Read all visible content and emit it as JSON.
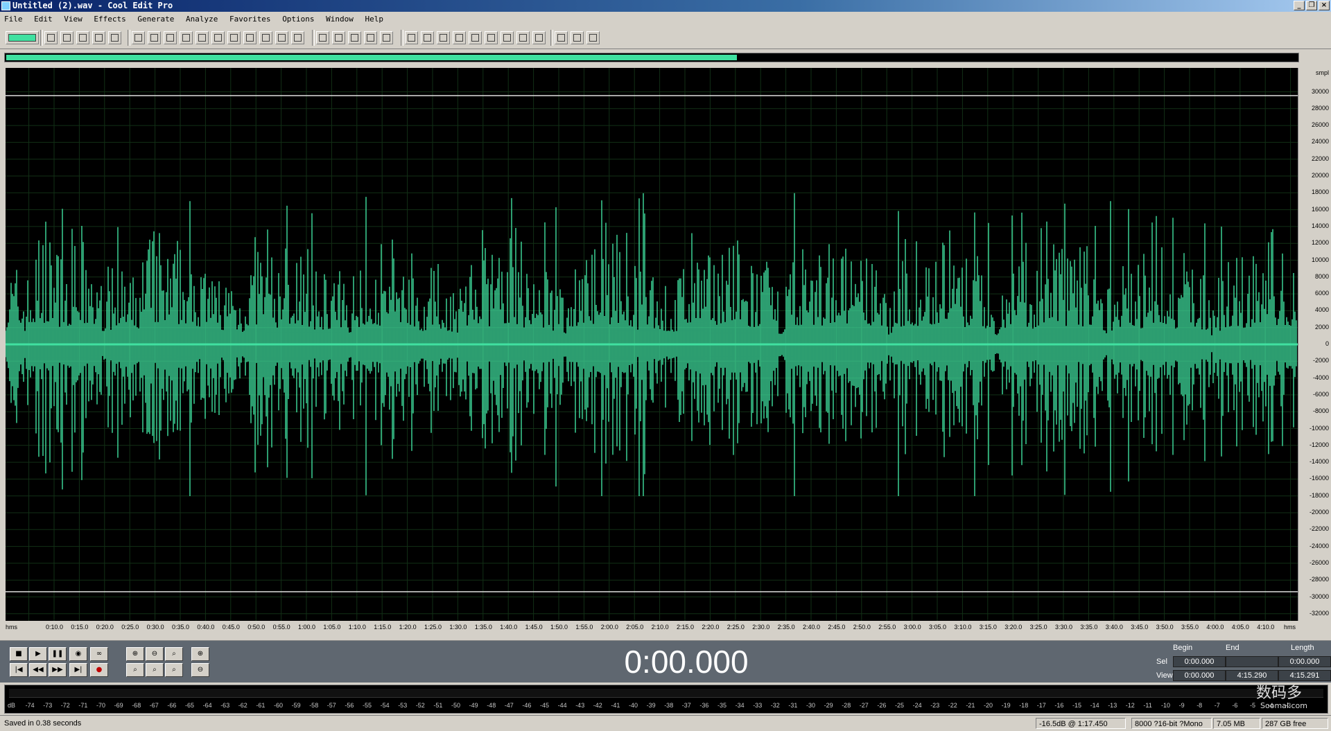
{
  "window": {
    "title": "Untitled (2).wav - Cool Edit Pro"
  },
  "menu": [
    "File",
    "Edit",
    "View",
    "Effects",
    "Generate",
    "Analyze",
    "Favorites",
    "Options",
    "Window",
    "Help"
  ],
  "colors": {
    "waveform": "#40e0a0",
    "background": "#000000",
    "grid": "#123016"
  },
  "waveform": {
    "amplitude_unit": "smpl",
    "amplitude_labels": [
      "30000",
      "28000",
      "26000",
      "24000",
      "22000",
      "20000",
      "18000",
      "16000",
      "14000",
      "12000",
      "10000",
      "8000",
      "6000",
      "4000",
      "2000",
      "0",
      "-2000",
      "-4000",
      "-6000",
      "-8000",
      "-10000",
      "-12000",
      "-14000",
      "-16000",
      "-18000",
      "-20000",
      "-22000",
      "-24000",
      "-26000",
      "-28000",
      "-30000",
      "-32000"
    ]
  },
  "timeline": {
    "unit_left": "hms",
    "unit_right": "hms",
    "labels": [
      "0:10.0",
      "0:15.0",
      "0:20.0",
      "0:25.0",
      "0:30.0",
      "0:35.0",
      "0:40.0",
      "0:45.0",
      "0:50.0",
      "0:55.0",
      "1:00.0",
      "1:05.0",
      "1:10.0",
      "1:15.0",
      "1:20.0",
      "1:25.0",
      "1:30.0",
      "1:35.0",
      "1:40.0",
      "1:45.0",
      "1:50.0",
      "1:55.0",
      "2:00.0",
      "2:05.0",
      "2:10.0",
      "2:15.0",
      "2:20.0",
      "2:25.0",
      "2:30.0",
      "2:35.0",
      "2:40.0",
      "2:45.0",
      "2:50.0",
      "2:55.0",
      "3:00.0",
      "3:05.0",
      "3:10.0",
      "3:15.0",
      "3:20.0",
      "3:25.0",
      "3:30.0",
      "3:35.0",
      "3:40.0",
      "3:45.0",
      "3:50.0",
      "3:55.0",
      "4:00.0",
      "4:05.0",
      "4:10.0"
    ]
  },
  "transport": {
    "time": "0:00.000",
    "headers": {
      "begin": "Begin",
      "end": "End",
      "length": "Length"
    },
    "sel": {
      "label": "Sel",
      "begin": "0:00.000",
      "end": "",
      "length": "0:00.000"
    },
    "view": {
      "label": "View",
      "begin": "0:00.000",
      "end": "4:15.290",
      "length": "4:15.291"
    }
  },
  "meter": {
    "labels": [
      "dB",
      "-74",
      "-73",
      "-72",
      "-71",
      "-70",
      "-69",
      "-68",
      "-67",
      "-66",
      "-65",
      "-64",
      "-63",
      "-62",
      "-61",
      "-60",
      "-59",
      "-58",
      "-57",
      "-56",
      "-55",
      "-54",
      "-53",
      "-52",
      "-51",
      "-50",
      "-49",
      "-48",
      "-47",
      "-46",
      "-45",
      "-44",
      "-43",
      "-42",
      "-41",
      "-40",
      "-39",
      "-38",
      "-37",
      "-36",
      "-35",
      "-34",
      "-33",
      "-32",
      "-31",
      "-30",
      "-29",
      "-28",
      "-27",
      "-26",
      "-25",
      "-24",
      "-23",
      "-22",
      "-21",
      "-20",
      "-19",
      "-18",
      "-17",
      "-16",
      "-15",
      "-14",
      "-13",
      "-12",
      "-11",
      "-10",
      "-9",
      "-8",
      "-7",
      "-6",
      "-5",
      "-4",
      "-3"
    ]
  },
  "status": {
    "message": "Saved in 0.38 seconds",
    "level": "-16.5dB @  1:17.450",
    "format": "8000 ?16-bit ?Mono",
    "size": "7.05 MB",
    "free": "287 GB free"
  },
  "watermark": {
    "text": "数码多",
    "sub": "Soomal.com"
  }
}
